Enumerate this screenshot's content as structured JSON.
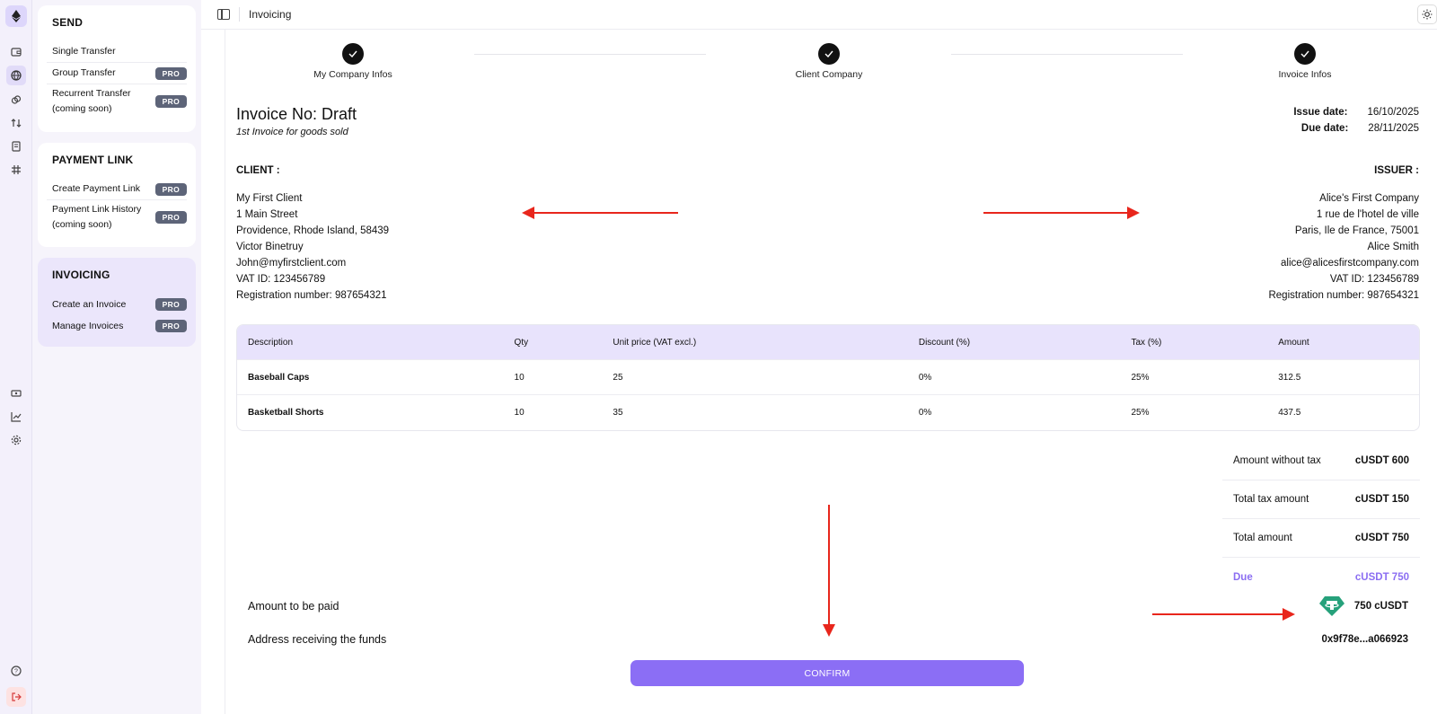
{
  "rail": {
    "icons": [
      "ethereum-logo-icon",
      "wallet-icon",
      "globe-icon",
      "link-icon",
      "transfer-icon",
      "document-icon",
      "hash-icon",
      "ticket-icon",
      "chart-icon",
      "gear-icon",
      "help-icon",
      "logout-icon"
    ]
  },
  "menu": {
    "send": {
      "title": "SEND",
      "items": [
        {
          "label": "Single Transfer",
          "badge": ""
        },
        {
          "label": "Group Transfer",
          "badge": "PRO"
        },
        {
          "label": "Recurrent Transfer",
          "label2": "(coming soon)",
          "badge": "PRO"
        }
      ]
    },
    "payment_link": {
      "title": "PAYMENT LINK",
      "items": [
        {
          "label": "Create Payment Link",
          "badge": "PRO"
        },
        {
          "label": "Payment Link History",
          "label2": "(coming soon)",
          "badge": "PRO"
        }
      ]
    },
    "invoicing": {
      "title": "INVOICING",
      "items": [
        {
          "label": "Create an Invoice",
          "badge": "PRO"
        },
        {
          "label": "Manage Invoices",
          "badge": "PRO"
        }
      ]
    }
  },
  "topbar": {
    "title": "Invoicing"
  },
  "steps": [
    "My Company Infos",
    "Client Company",
    "Invoice Infos"
  ],
  "invoice": {
    "title": "Invoice No: Draft",
    "subtitle": "1st Invoice for goods sold",
    "issue_label": "Issue date:",
    "issue_date": "16/10/2025",
    "due_label": "Due date:",
    "due_date": "28/11/2025"
  },
  "client": {
    "heading": "CLIENT :",
    "lines": [
      "My First Client",
      "1 Main Street",
      "Providence, Rhode Island, 58439",
      "Victor Binetruy",
      "John@myfirstclient.com",
      "VAT ID: 123456789",
      "Registration number: 987654321"
    ]
  },
  "issuer": {
    "heading": "ISSUER :",
    "lines": [
      "Alice's First Company",
      "1 rue de l'hotel de ville",
      "Paris, Ile de France, 75001",
      "Alice Smith",
      "alice@alicesfirstcompany.com",
      "VAT ID: 123456789",
      "Registration number: 987654321"
    ]
  },
  "table": {
    "headers": [
      "Description",
      "Qty",
      "Unit price (VAT excl.)",
      "Discount (%)",
      "Tax (%)",
      "Amount"
    ],
    "rows": [
      [
        "Baseball Caps",
        "10",
        "25",
        "0%",
        "25%",
        "312.5"
      ],
      [
        "Basketball Shorts",
        "10",
        "35",
        "0%",
        "25%",
        "437.5"
      ]
    ]
  },
  "totals": {
    "without_tax_label": "Amount without tax",
    "without_tax": "cUSDT 600",
    "tax_label": "Total tax amount",
    "tax": "cUSDT 150",
    "total_label": "Total amount",
    "total": "cUSDT 750",
    "due_label": "Due",
    "due": "cUSDT 750"
  },
  "payment": {
    "amount_label": "Amount to be paid",
    "amount_value": "750 cUSDT",
    "address_label": "Address receiving the funds",
    "address_value": "0x9f78e...a066923",
    "confirm_label": "CONFIRM"
  },
  "colors": {
    "accent": "#8b6ef5",
    "annotation_arrow": "#e8261c",
    "tether": "#26a17b"
  }
}
